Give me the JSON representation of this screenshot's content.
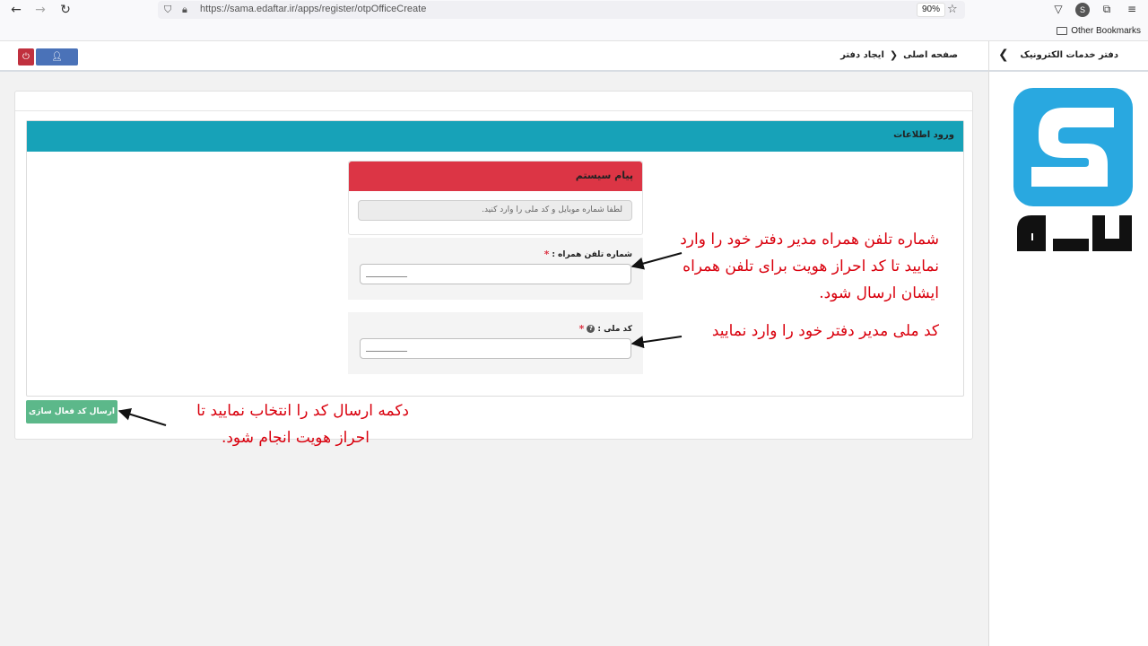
{
  "browser": {
    "url": "https://sama.edaftar.ir/apps/register/otpOfficeCreate",
    "zoom": "90%",
    "profile_initial": "S",
    "bookmarks": "Other Bookmarks"
  },
  "header": {
    "breadcrumb_home": "صفحه اصلی",
    "breadcrumb_current": "ایجاد دفتر"
  },
  "sidebar": {
    "title": "دفتر خدمات الکترونیک"
  },
  "panel": {
    "title": "ورود اطلاعات"
  },
  "message": {
    "title": "پیام سیستم",
    "text": "لطفا شماره موبایل و کد ملی را وارد کنید."
  },
  "fields": {
    "phone_label": "شماره تلفن همراه :",
    "national_id_label": "کد ملی :",
    "required_mark": "*"
  },
  "actions": {
    "submit_label": "ارسال کد فعال سازی"
  },
  "annotations": {
    "phone_line1": "شماره تلفن همراه مدیر دفتر خود را وارد",
    "phone_line2": "نمایید تا کد احراز هویت برای تلفن همراه",
    "phone_line3": "ایشان ارسال شود.",
    "national_id_note": "کد ملی مدیر دفتر خود را وارد نمایید",
    "submit_line1": "دکمه ارسال کد را انتخاب نمایید تا",
    "submit_line2": "احراز هویت انجام شود."
  },
  "colors": {
    "panel_header": "#17a2b8",
    "message_header": "#dc3545",
    "submit_button": "#5cb88a",
    "annotation_text": "#d9000d"
  }
}
